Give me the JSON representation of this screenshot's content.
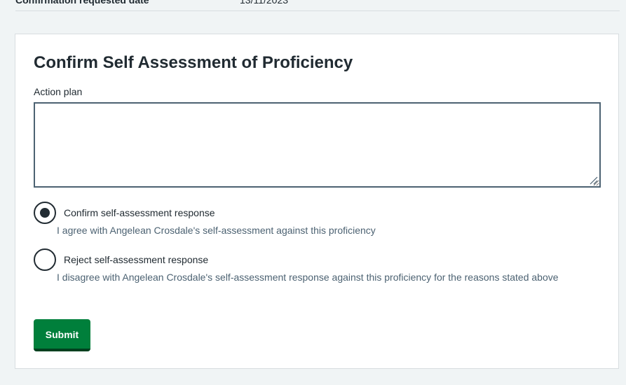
{
  "summary_row": {
    "key": "Confirmation requested date",
    "value": "13/11/2023"
  },
  "form": {
    "title": "Confirm Self Assessment of Proficiency",
    "action_plan_label": "Action plan",
    "action_plan_value": "",
    "options": [
      {
        "label": "Confirm self-assessment response",
        "hint": "I agree with Angelean Crosdale's self-assessment against this proficiency",
        "selected": true
      },
      {
        "label": "Reject self-assessment response",
        "hint": "I disagree with Angelean Crosdale's self-assessment response against this proficiency for the reasons stated above",
        "selected": false
      }
    ],
    "submit_label": "Submit"
  },
  "colors": {
    "page_background": "#f0f4f5",
    "card_background": "#ffffff",
    "primary_button": "#007f3b",
    "text": "#212b32",
    "hint_text": "#4c6272"
  },
  "icons": {
    "resize_handle": "resize-grip-icon",
    "radio_selected": "radio-selected-icon",
    "radio_unselected": "radio-unselected-icon"
  }
}
